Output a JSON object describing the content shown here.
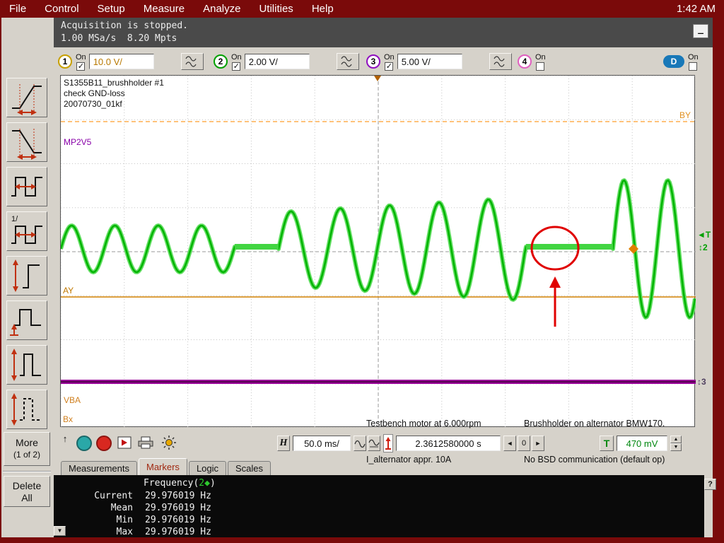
{
  "menu": {
    "items": [
      "File",
      "Control",
      "Setup",
      "Measure",
      "Analyze",
      "Utilities",
      "Help"
    ],
    "clock": "1:42 AM"
  },
  "status": {
    "line1": "Acquisition is stopped.",
    "line2": "1.00 MSa/s  8.20 Mpts",
    "minimize": "_"
  },
  "channels": {
    "items": [
      {
        "num": "1",
        "on_label": "On",
        "checked": true,
        "scale": "10.0 V/",
        "color": "#C8A000",
        "text_color": "#B87800"
      },
      {
        "num": "2",
        "on_label": "On",
        "checked": true,
        "scale": "2.00 V/",
        "color": "#00A000",
        "text_color": "#111111"
      },
      {
        "num": "3",
        "on_label": "On",
        "checked": true,
        "scale": "5.00 V/",
        "color": "#9010C0",
        "text_color": "#111111"
      },
      {
        "num": "4",
        "on_label": "On",
        "checked": false,
        "scale": "",
        "color": "#E060C0",
        "text_color": "#111111"
      }
    ],
    "digital": {
      "label": "D",
      "on_label": "On",
      "checked": false
    }
  },
  "sidebar": {
    "more_line1": "More",
    "more_line2": "(1 of 2)",
    "delete_line1": "Delete",
    "delete_line2": "All"
  },
  "plot": {
    "annotation1": "S1355B11_brushholder #1",
    "annotation2": "check GND-loss",
    "annotation3": "20070730_01kf",
    "probe_label": "MP2V5",
    "marker_by": "BY",
    "marker_ay": "AY",
    "marker_vba": "VBA",
    "marker_bx": "Bx",
    "note_left1": "Testbench motor at 6.000rpm",
    "note_left2": "I_alternator appr. 10A",
    "note_right1": "Brushholder on alternator BMW170.",
    "note_right2": "No BSD communication (default op)",
    "trig_marker": "◄T",
    "ch2_marker": "↕2",
    "ch3_marker": "↕3",
    "trace_color": "#00B400",
    "ch3_color": "#9A009A",
    "annotation_color": "#E00000"
  },
  "hbar": {
    "h_label": "H",
    "timebase": "50.0 ms/",
    "position": "2.3612580000 s",
    "left_arrow": "◄",
    "zero": "0",
    "right_arrow": "►",
    "trig_label": "T",
    "trig_level": "470 mV",
    "spin_up": "▲",
    "spin_down": "▼",
    "up_icon": "↑"
  },
  "tabs": {
    "items": [
      {
        "label": "Measurements",
        "active": false
      },
      {
        "label": "Markers",
        "active": true
      },
      {
        "label": "Logic",
        "active": false
      },
      {
        "label": "Scales",
        "active": false
      }
    ]
  },
  "measurements": {
    "header_name": "Frequency(",
    "header_source": "2",
    "header_marker": "◆",
    "header_close": ")",
    "rows": [
      {
        "label": "Current",
        "value": "29.976019 Hz"
      },
      {
        "label": "Mean",
        "value": "29.976019 Hz"
      },
      {
        "label": "Min",
        "value": "29.976019 Hz"
      },
      {
        "label": "Max",
        "value": "29.976019 Hz"
      }
    ],
    "help": "?",
    "scroll_down": "▼"
  }
}
